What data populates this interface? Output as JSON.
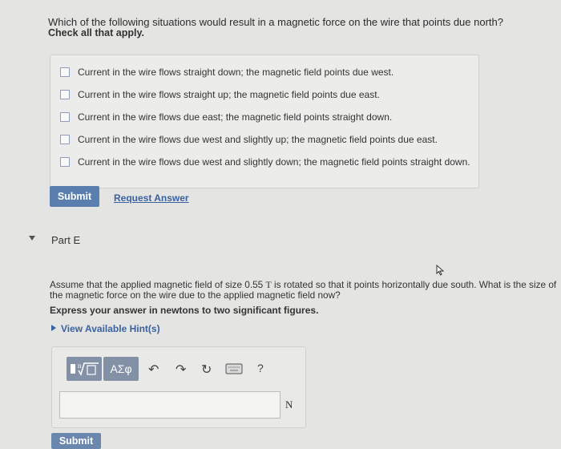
{
  "question": {
    "text": "Which of the following situations would result in a magnetic force on the wire that points due north?",
    "instruction": "Check all that apply."
  },
  "options": [
    "Current in the wire flows straight down; the magnetic field points due west.",
    "Current in the wire flows straight up; the magnetic field points due east.",
    "Current in the wire flows due east; the magnetic field points straight down.",
    "Current in the wire flows due west and slightly up; the magnetic field points due east.",
    "Current in the wire flows due west and slightly down; the magnetic field points straight down."
  ],
  "actions": {
    "submit_label": "Submit",
    "request_answer_label": "Request Answer"
  },
  "part_e": {
    "label": "Part E",
    "prompt_a": "Assume that the applied magnetic field of size 0.55 ",
    "prompt_unit": "T",
    "prompt_b": " is rotated so that it points horizontally due south. What is the size of the magnetic force on the wire due to the applied magnetic field now?",
    "express": "Express your answer in newtons to two significant figures.",
    "hint_label": "View Available Hint(s)",
    "toolbar": {
      "template_icon": "fraction-radical-template-icon",
      "greek_label": "ΑΣφ",
      "undo_icon": "undo-icon",
      "redo_icon": "redo-icon",
      "reset_icon": "reset-icon",
      "keyboard_icon": "keyboard-icon",
      "help_label": "?"
    },
    "answer_value": "",
    "unit": "N",
    "submit_label": "Submit"
  }
}
